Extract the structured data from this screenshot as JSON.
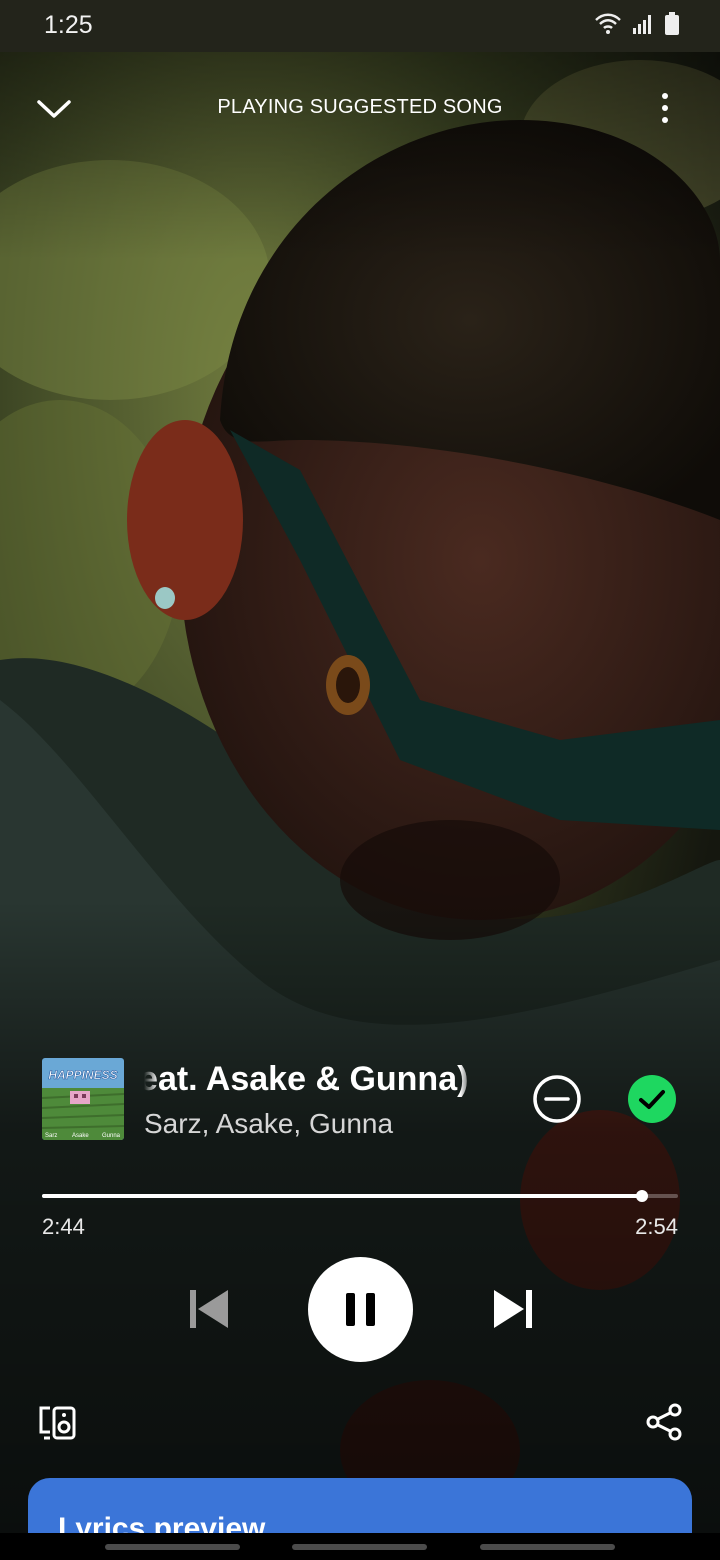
{
  "status_bar": {
    "time": "1:25"
  },
  "header": {
    "title": "PLAYING SUGGESTED SONG"
  },
  "track": {
    "title": "Happiness (feat. Asake & Gunna)",
    "artists": "Sarz, Asake, Gunna",
    "cover_art": {
      "wordmark": "HAPPINESS",
      "credits": [
        "Sarz",
        "Asake",
        "Gunna"
      ]
    }
  },
  "playback": {
    "elapsed": "2:44",
    "duration": "2:54",
    "progress_fraction": 0.943,
    "state": "playing"
  },
  "icons": {
    "collapse": "chevron-down-icon",
    "more": "more-vertical-icon",
    "hide": "hide-minus-circle-icon",
    "liked": "check-circle-icon",
    "previous": "skip-previous-icon",
    "pause": "pause-icon",
    "next": "skip-next-icon",
    "devices": "connect-devices-icon",
    "share": "share-icon"
  },
  "colors": {
    "accent_green": "#1ed760",
    "lyrics_card": "#3b75d8"
  },
  "lyrics": {
    "title": "Lyrics preview"
  }
}
